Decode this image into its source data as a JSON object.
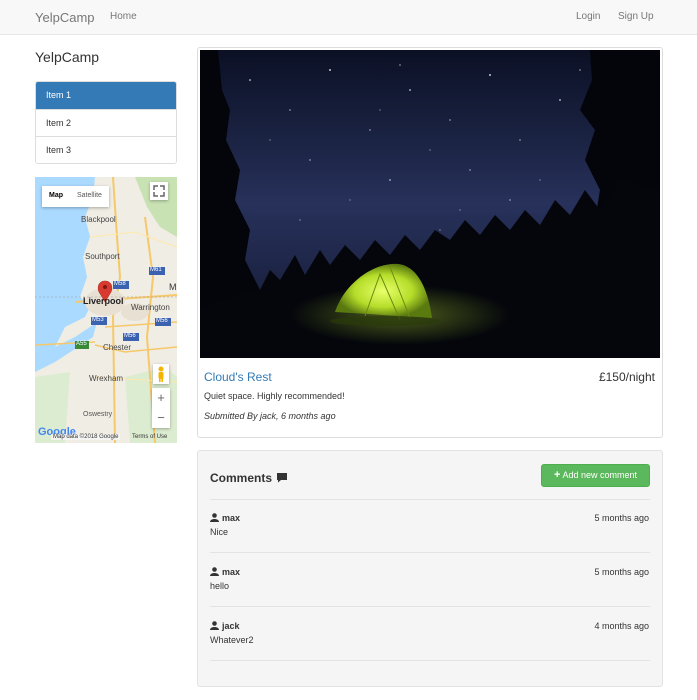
{
  "navbar": {
    "brand": "YelpCamp",
    "home": "Home",
    "login": "Login",
    "signup": "Sign Up"
  },
  "sidebar": {
    "lead": "YelpCamp",
    "items": [
      {
        "label": "Item 1",
        "active": true
      },
      {
        "label": "Item 2",
        "active": false
      },
      {
        "label": "Item 3",
        "active": false
      }
    ]
  },
  "map": {
    "type_map": "Map",
    "type_satellite": "Satellite",
    "credit": "Map data ©2018 Google",
    "terms": "Terms of Use",
    "google_logo": "Google",
    "labels": {
      "blackpool": "Blackpool",
      "southport": "Southport",
      "liverpool": "Liverpool",
      "warrington": "Warrington",
      "chester": "Chester",
      "wrexham": "Wrexham",
      "oswestry": "Oswestry",
      "m61": "M61",
      "m58": "M58",
      "m53": "M53",
      "m56": "M56",
      "m6": "M6",
      "a55": "A55",
      "m_edge": "M",
      "zoom_in": "+",
      "zoom_out": "−"
    },
    "marker_color": "#d93a2f"
  },
  "campground": {
    "name": "Cloud's Rest",
    "price": "£150/night",
    "description": "Quiet space. Highly recommended!",
    "submitted": "Submitted By jack, 6 months ago"
  },
  "comments": {
    "title": "Comments",
    "add_label": "Add new comment",
    "items": [
      {
        "author": "max",
        "time": "5 months ago",
        "text": "Nice"
      },
      {
        "author": "max",
        "time": "5 months ago",
        "text": "hello"
      },
      {
        "author": "jack",
        "time": "4 months ago",
        "text": "Whatever2"
      }
    ]
  },
  "colors": {
    "link": "#337ab7",
    "success": "#5cb85c",
    "active": "#337ab7"
  }
}
